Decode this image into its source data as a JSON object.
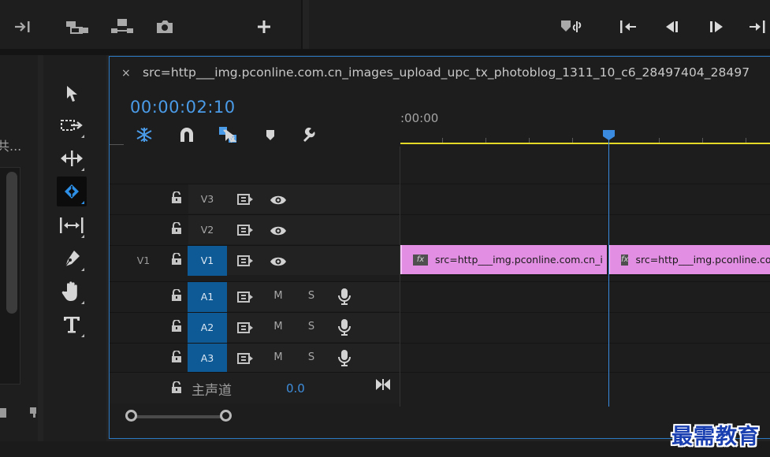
{
  "colors": {
    "accent_blue": "#4a9be8",
    "timeline_border": "#2b79c2",
    "track_target": "#0e5a96",
    "clip_pink": "#e28ee2",
    "work_area_yellow": "#e5d928",
    "playhead": "#3a8ae0"
  },
  "top_toolbar": {
    "left_icons": [
      "insert-track-icon",
      "extract-icon",
      "lift-icon",
      "camera-icon",
      "add-button-icon"
    ],
    "right_icons": [
      "marker-link-icon",
      "go-to-in-icon",
      "step-back-icon",
      "step-forward-icon",
      "go-to-out-icon"
    ]
  },
  "project_panel": {
    "label": "共..."
  },
  "tools": [
    "selection-tool",
    "track-select-tool",
    "ripple-edit-tool",
    "razor-tool",
    "slip-tool",
    "pen-tool",
    "hand-tool",
    "type-tool"
  ],
  "timeline": {
    "close_symbol": "×",
    "sequence_name": "src=http___img.pconline.com.cn_images_upload_upc_tx_photoblog_1311_10_c6_28497404_28497",
    "timecode": "00:00:02:10",
    "ruler_start": ":00:00",
    "header_tools": [
      "nest-icon",
      "snap-icon",
      "linked-selection-icon",
      "add-marker-icon",
      "settings-wrench-icon"
    ]
  },
  "tracks": {
    "video": [
      {
        "source": "",
        "target": "V3",
        "targeted": false
      },
      {
        "source": "",
        "target": "V2",
        "targeted": false
      },
      {
        "source": "V1",
        "target": "V1",
        "targeted": true
      }
    ],
    "audio": [
      {
        "target": "A1",
        "mute": "M",
        "solo": "S",
        "targeted": true
      },
      {
        "target": "A2",
        "mute": "M",
        "solo": "S",
        "targeted": true
      },
      {
        "target": "A3",
        "mute": "M",
        "solo": "S",
        "targeted": true
      }
    ],
    "master": {
      "label": "主声道",
      "value": "0.0"
    }
  },
  "clips": [
    {
      "fx": "fx",
      "name": "src=http___img.pconline.com.cn_i"
    },
    {
      "fx": "fx",
      "name": "src=http___img.pconline.com.cn_images"
    }
  ],
  "watermark": "最需教育"
}
